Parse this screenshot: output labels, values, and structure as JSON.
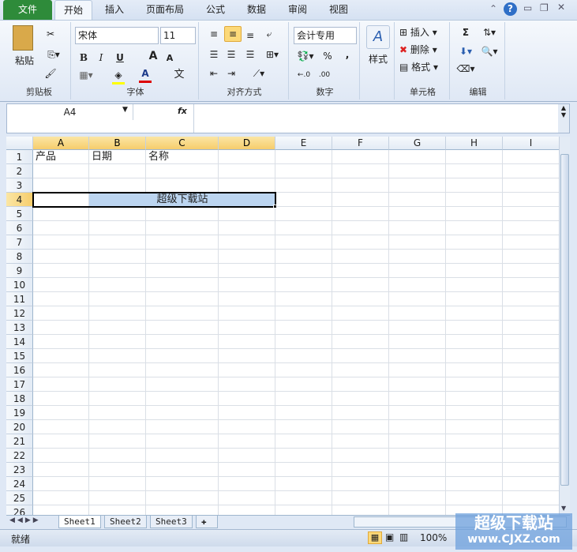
{
  "tabs": [
    "文件",
    "开始",
    "插入",
    "页面布局",
    "公式",
    "数据",
    "审阅",
    "视图"
  ],
  "ribbon": {
    "clipboard": {
      "paste": "粘贴",
      "label": "剪贴板"
    },
    "font": {
      "name": "宋体",
      "size": "11",
      "bold": "B",
      "italic": "I",
      "underline": "U",
      "label": "字体",
      "grow": "A",
      "shrink": "A",
      "color": "A",
      "phonetic": "文"
    },
    "alignment": {
      "label": "对齐方式"
    },
    "number": {
      "format": "会计专用",
      "percent": "%",
      "comma": ",",
      "inc": "←.0",
      "dec": ".00",
      "label": "数字"
    },
    "styles": {
      "label": "样式"
    },
    "cells": {
      "insert": "插入",
      "delete": "删除",
      "format": "格式",
      "label": "单元格"
    },
    "editing": {
      "sum": "Σ",
      "label": "编辑"
    }
  },
  "formula_bar": {
    "name_box": "A4",
    "fx": "fx",
    "value": ""
  },
  "columns": [
    "A",
    "B",
    "C",
    "D",
    "E",
    "F",
    "G",
    "H",
    "I"
  ],
  "rows": 26,
  "selected": {
    "column_letters": [
      "A",
      "B",
      "C",
      "D"
    ],
    "row": 4
  },
  "cells": {
    "A1": "产品",
    "B1": "日期",
    "C1": "名称",
    "B4": "超级下载站"
  },
  "sheets": [
    "Sheet1",
    "Sheet2",
    "Sheet3"
  ],
  "status": {
    "ready": "就绪",
    "zoom": "100%"
  },
  "watermark": {
    "line1": "超级下载站",
    "line2": "www.CJXZ.com"
  },
  "colors": {
    "file_tab": "#2e8b3a",
    "selection_fill": "#bcd5f0",
    "header_selected": "#f6cd6c"
  }
}
